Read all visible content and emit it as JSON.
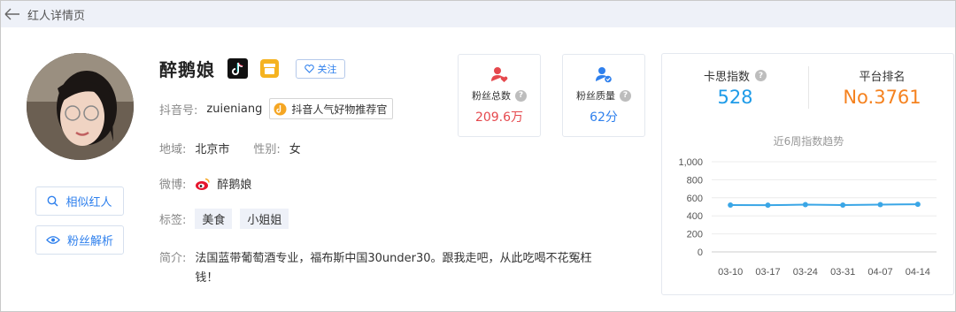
{
  "header": {
    "title": "红人详情页"
  },
  "profile": {
    "name": "醉鹅娘",
    "follow_label": "关注",
    "douyin_id_label": "抖音号:",
    "douyin_id": "zuieniang",
    "official_tag": "抖音人气好物推荐官",
    "region_label": "地域:",
    "region": "北京市",
    "gender_label": "性别:",
    "gender": "女",
    "weibo_label": "微博:",
    "weibo": "醉鹅娘",
    "tags_label": "标签:",
    "tags": [
      "美食",
      "小姐姐"
    ],
    "intro_label": "简介:",
    "intro": "法国蓝带葡萄酒专业，福布斯中国30under30。跟我走吧，从此吃喝不花冤枉钱！"
  },
  "side_buttons": {
    "similar": "相似红人",
    "fans": "粉丝解析"
  },
  "stats": {
    "fans_total_label": "粉丝总数",
    "fans_total": "209.6万",
    "fans_quality_label": "粉丝质量",
    "fans_quality": "62分",
    "value_color_red": "#e5484d",
    "value_color_blue": "#2f80ed"
  },
  "kpis": {
    "kasi_label": "卡思指数",
    "kasi_value": "528",
    "kasi_color": "#1e9be8",
    "rank_label": "平台排名",
    "rank_value": "No.3761",
    "rank_color": "#f5821f"
  },
  "chart_data": {
    "type": "line",
    "title": "近6周指数趋势",
    "categories": [
      "03-10",
      "03-17",
      "03-24",
      "03-31",
      "04-07",
      "04-14"
    ],
    "values": [
      520,
      518,
      524,
      520,
      525,
      528
    ],
    "ylim": [
      0,
      1000
    ],
    "yticks": [
      "0",
      "200",
      "400",
      "600",
      "800",
      "1,000"
    ],
    "grid": true,
    "color": "#3aa6e6"
  }
}
